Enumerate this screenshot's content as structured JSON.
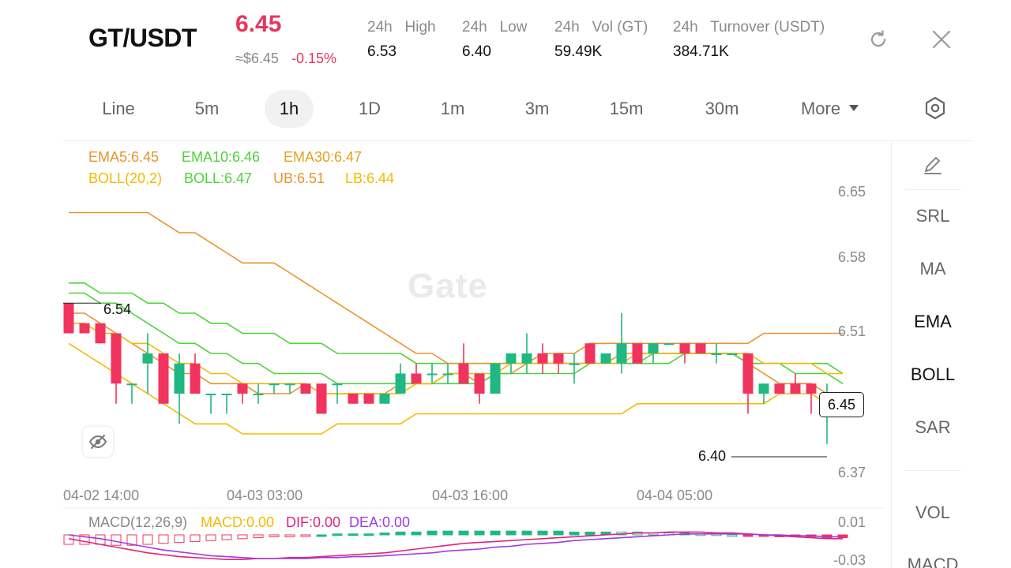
{
  "header": {
    "pair": "GT/USDT",
    "price": "6.45",
    "approx_usd": "≈$6.45",
    "change_pct": "-0.15%",
    "stats": [
      {
        "label": "24h   High",
        "value": "6.53"
      },
      {
        "label": "24h   Low",
        "value": "6.40"
      },
      {
        "label": "24h   Vol (GT)",
        "value": "59.49K"
      },
      {
        "label": "24h   Turnover (USDT)",
        "value": "384.71K"
      }
    ],
    "icons": [
      "refresh-icon",
      "close-icon"
    ]
  },
  "tabs": [
    {
      "label": "Line",
      "active": false
    },
    {
      "label": "5m",
      "active": false
    },
    {
      "label": "1h",
      "active": true
    },
    {
      "label": "1D",
      "active": false
    },
    {
      "label": "1m",
      "active": false
    },
    {
      "label": "3m",
      "active": false
    },
    {
      "label": "15m",
      "active": false
    },
    {
      "label": "30m",
      "active": false
    },
    {
      "label": "More",
      "active": false
    }
  ],
  "indicators": {
    "ema5": "EMA5:6.45",
    "ema10": "EMA10:6.46",
    "ema30": "EMA30:6.47",
    "boll_params": "BOLL(20,2)",
    "boll": "BOLL:6.47",
    "ub": "UB:6.51",
    "lb": "LB:6.44"
  },
  "macd": {
    "params": "MACD(12,26,9)",
    "macd": "MACD:0.00",
    "dif": "DIF:0.00",
    "dea": "DEA:0.00"
  },
  "sidepanel": [
    "SRL",
    "MA",
    "EMA",
    "BOLL",
    "SAR",
    "VOL",
    "MACD"
  ],
  "colors": {
    "up": "#1fb882",
    "down": "#f0345e",
    "ema5": "#e8932d",
    "ema10": "#4bd438",
    "ema30": "#e8a020",
    "boll": "#f5b800",
    "macd": "#f5b800",
    "dif": "#e0247d",
    "dea": "#a03be0"
  },
  "chart_data": {
    "type": "candlestick",
    "y_axis_ticks": [
      "6.65",
      "6.58",
      "6.51",
      "6.37"
    ],
    "x_axis_ticks": [
      "04-02 14:00",
      "04-03 03:00",
      "04-03 16:00",
      "04-04 05:00"
    ],
    "last_price": "6.45",
    "high_marker": "6.54",
    "low_marker": "6.40",
    "macd_axis": [
      "0.01",
      "-0.03"
    ],
    "candles": [
      {
        "o": 6.54,
        "h": 6.54,
        "l": 6.51,
        "c": 6.51
      },
      {
        "o": 6.52,
        "h": 6.52,
        "l": 6.51,
        "c": 6.51
      },
      {
        "o": 6.52,
        "h": 6.52,
        "l": 6.5,
        "c": 6.5
      },
      {
        "o": 6.51,
        "h": 6.51,
        "l": 6.44,
        "c": 6.46
      },
      {
        "o": 6.46,
        "h": 6.46,
        "l": 6.44,
        "c": 6.46
      },
      {
        "o": 6.48,
        "h": 6.51,
        "l": 6.45,
        "c": 6.49
      },
      {
        "o": 6.49,
        "h": 6.49,
        "l": 6.44,
        "c": 6.44
      },
      {
        "o": 6.45,
        "h": 6.49,
        "l": 6.42,
        "c": 6.48
      },
      {
        "o": 6.48,
        "h": 6.49,
        "l": 6.45,
        "c": 6.45
      },
      {
        "o": 6.45,
        "h": 6.45,
        "l": 6.43,
        "c": 6.45
      },
      {
        "o": 6.45,
        "h": 6.45,
        "l": 6.43,
        "c": 6.45
      },
      {
        "o": 6.46,
        "h": 6.46,
        "l": 6.44,
        "c": 6.45
      },
      {
        "o": 6.45,
        "h": 6.46,
        "l": 6.44,
        "c": 6.45
      },
      {
        "o": 6.46,
        "h": 6.46,
        "l": 6.45,
        "c": 6.46
      },
      {
        "o": 6.46,
        "h": 6.46,
        "l": 6.45,
        "c": 6.46
      },
      {
        "o": 6.46,
        "h": 6.46,
        "l": 6.45,
        "c": 6.45
      },
      {
        "o": 6.46,
        "h": 6.46,
        "l": 6.43,
        "c": 6.43
      },
      {
        "o": 6.46,
        "h": 6.46,
        "l": 6.44,
        "c": 6.46
      },
      {
        "o": 6.45,
        "h": 6.45,
        "l": 6.44,
        "c": 6.44
      },
      {
        "o": 6.45,
        "h": 6.45,
        "l": 6.44,
        "c": 6.44
      },
      {
        "o": 6.44,
        "h": 6.45,
        "l": 6.44,
        "c": 6.45
      },
      {
        "o": 6.45,
        "h": 6.48,
        "l": 6.45,
        "c": 6.47
      },
      {
        "o": 6.47,
        "h": 6.48,
        "l": 6.46,
        "c": 6.46
      },
      {
        "o": 6.47,
        "h": 6.48,
        "l": 6.46,
        "c": 6.47
      },
      {
        "o": 6.47,
        "h": 6.48,
        "l": 6.46,
        "c": 6.47
      },
      {
        "o": 6.48,
        "h": 6.5,
        "l": 6.46,
        "c": 6.46
      },
      {
        "o": 6.47,
        "h": 6.47,
        "l": 6.44,
        "c": 6.45
      },
      {
        "o": 6.45,
        "h": 6.48,
        "l": 6.45,
        "c": 6.48
      },
      {
        "o": 6.48,
        "h": 6.49,
        "l": 6.47,
        "c": 6.49
      },
      {
        "o": 6.48,
        "h": 6.51,
        "l": 6.47,
        "c": 6.49
      },
      {
        "o": 6.49,
        "h": 6.5,
        "l": 6.47,
        "c": 6.48
      },
      {
        "o": 6.49,
        "h": 6.49,
        "l": 6.47,
        "c": 6.48
      },
      {
        "o": 6.48,
        "h": 6.49,
        "l": 6.46,
        "c": 6.48
      },
      {
        "o": 6.5,
        "h": 6.5,
        "l": 6.48,
        "c": 6.48
      },
      {
        "o": 6.48,
        "h": 6.49,
        "l": 6.48,
        "c": 6.49
      },
      {
        "o": 6.48,
        "h": 6.53,
        "l": 6.47,
        "c": 6.5
      },
      {
        "o": 6.5,
        "h": 6.5,
        "l": 6.48,
        "c": 6.48
      },
      {
        "o": 6.49,
        "h": 6.5,
        "l": 6.48,
        "c": 6.5
      },
      {
        "o": 6.5,
        "h": 6.5,
        "l": 6.5,
        "c": 6.5
      },
      {
        "o": 6.5,
        "h": 6.5,
        "l": 6.48,
        "c": 6.49
      },
      {
        "o": 6.5,
        "h": 6.5,
        "l": 6.49,
        "c": 6.49
      },
      {
        "o": 6.49,
        "h": 6.5,
        "l": 6.48,
        "c": 6.49
      },
      {
        "o": 6.49,
        "h": 6.49,
        "l": 6.49,
        "c": 6.49
      },
      {
        "o": 6.49,
        "h": 6.49,
        "l": 6.43,
        "c": 6.45
      },
      {
        "o": 6.45,
        "h": 6.46,
        "l": 6.44,
        "c": 6.46
      },
      {
        "o": 6.46,
        "h": 6.46,
        "l": 6.45,
        "c": 6.45
      },
      {
        "o": 6.46,
        "h": 6.47,
        "l": 6.45,
        "c": 6.45
      },
      {
        "o": 6.46,
        "h": 6.46,
        "l": 6.43,
        "c": 6.45
      },
      {
        "o": 6.45,
        "h": 6.46,
        "l": 6.4,
        "c": 6.45
      },
      {
        "o": 6.45,
        "h": 6.45,
        "l": 6.45,
        "c": 6.45
      }
    ],
    "series": [
      {
        "name": "EMA5",
        "values": [
          6.53,
          6.53,
          6.52,
          6.51,
          6.5,
          6.49,
          6.48,
          6.47,
          6.47,
          6.46,
          6.46,
          6.46,
          6.45,
          6.45,
          6.45,
          6.46,
          6.45,
          6.45,
          6.45,
          6.45,
          6.45,
          6.46,
          6.46,
          6.46,
          6.47,
          6.47,
          6.46,
          6.47,
          6.47,
          6.48,
          6.48,
          6.48,
          6.48,
          6.48,
          6.48,
          6.49,
          6.49,
          6.49,
          6.49,
          6.49,
          6.49,
          6.49,
          6.49,
          6.48,
          6.47,
          6.46,
          6.46,
          6.46,
          6.45,
          6.45
        ]
      },
      {
        "name": "EMA10",
        "values": [
          6.55,
          6.55,
          6.54,
          6.54,
          6.53,
          6.52,
          6.51,
          6.5,
          6.5,
          6.49,
          6.49,
          6.48,
          6.48,
          6.47,
          6.47,
          6.47,
          6.47,
          6.46,
          6.46,
          6.46,
          6.46,
          6.46,
          6.46,
          6.46,
          6.46,
          6.46,
          6.46,
          6.47,
          6.47,
          6.47,
          6.47,
          6.47,
          6.47,
          6.48,
          6.48,
          6.48,
          6.48,
          6.48,
          6.48,
          6.49,
          6.49,
          6.49,
          6.49,
          6.48,
          6.48,
          6.48,
          6.47,
          6.47,
          6.47,
          6.46
        ]
      },
      {
        "name": "EMA30",
        "values": [
          6.56,
          6.56,
          6.55,
          6.55,
          6.55,
          6.54,
          6.54,
          6.53,
          6.53,
          6.52,
          6.52,
          6.51,
          6.51,
          6.51,
          6.5,
          6.5,
          6.5,
          6.49,
          6.49,
          6.49,
          6.49,
          6.49,
          6.48,
          6.48,
          6.48,
          6.48,
          6.48,
          6.48,
          6.48,
          6.48,
          6.48,
          6.48,
          6.48,
          6.48,
          6.48,
          6.48,
          6.48,
          6.49,
          6.49,
          6.49,
          6.49,
          6.49,
          6.49,
          6.48,
          6.48,
          6.48,
          6.48,
          6.48,
          6.48,
          6.47
        ]
      },
      {
        "name": "UB",
        "values": [
          6.63,
          6.63,
          6.63,
          6.63,
          6.63,
          6.63,
          6.62,
          6.61,
          6.61,
          6.6,
          6.59,
          6.58,
          6.58,
          6.58,
          6.57,
          6.56,
          6.55,
          6.54,
          6.53,
          6.52,
          6.51,
          6.5,
          6.49,
          6.49,
          6.48,
          6.48,
          6.48,
          6.48,
          6.48,
          6.48,
          6.49,
          6.49,
          6.49,
          6.5,
          6.5,
          6.5,
          6.5,
          6.5,
          6.5,
          6.5,
          6.5,
          6.5,
          6.5,
          6.5,
          6.51,
          6.51,
          6.51,
          6.51,
          6.51,
          6.51
        ]
      },
      {
        "name": "BOLL",
        "values": [
          6.52,
          6.52,
          6.51,
          6.51,
          6.5,
          6.5,
          6.49,
          6.48,
          6.48,
          6.47,
          6.47,
          6.46,
          6.46,
          6.46,
          6.46,
          6.46,
          6.45,
          6.45,
          6.45,
          6.45,
          6.45,
          6.45,
          6.46,
          6.46,
          6.47,
          6.47,
          6.47,
          6.47,
          6.48,
          6.48,
          6.48,
          6.48,
          6.48,
          6.48,
          6.48,
          6.48,
          6.49,
          6.49,
          6.49,
          6.49,
          6.49,
          6.49,
          6.49,
          6.49,
          6.48,
          6.48,
          6.48,
          6.48,
          6.47,
          6.47
        ]
      },
      {
        "name": "LB",
        "values": [
          6.5,
          6.49,
          6.48,
          6.47,
          6.46,
          6.45,
          6.44,
          6.43,
          6.42,
          6.42,
          6.42,
          6.41,
          6.41,
          6.41,
          6.41,
          6.41,
          6.41,
          6.42,
          6.42,
          6.42,
          6.42,
          6.42,
          6.43,
          6.43,
          6.43,
          6.43,
          6.43,
          6.43,
          6.43,
          6.43,
          6.43,
          6.43,
          6.43,
          6.43,
          6.43,
          6.43,
          6.44,
          6.44,
          6.44,
          6.44,
          6.44,
          6.44,
          6.44,
          6.44,
          6.44,
          6.45,
          6.45,
          6.45,
          6.44,
          6.44
        ]
      }
    ],
    "macd_hist": [
      -0.01,
      -0.01,
      -0.01,
      -0.011,
      -0.011,
      -0.01,
      -0.009,
      -0.008,
      -0.007,
      -0.006,
      -0.005,
      -0.004,
      -0.003,
      -0.002,
      -0.002,
      -0.001,
      0.0,
      0.001,
      0.001,
      0.001,
      0.002,
      0.003,
      0.003,
      0.004,
      0.004,
      0.004,
      0.004,
      0.004,
      0.004,
      0.004,
      0.004,
      0.004,
      0.003,
      0.003,
      0.003,
      0.003,
      0.003,
      0.002,
      0.002,
      0.002,
      0.001,
      0.001,
      0.0,
      -0.001,
      -0.001,
      -0.002,
      -0.002,
      -0.002,
      -0.003,
      -0.003
    ],
    "dif": [
      -0.004,
      -0.007,
      -0.01,
      -0.013,
      -0.016,
      -0.019,
      -0.021,
      -0.023,
      -0.024,
      -0.025,
      -0.026,
      -0.026,
      -0.025,
      -0.025,
      -0.024,
      -0.024,
      -0.023,
      -0.022,
      -0.021,
      -0.02,
      -0.019,
      -0.017,
      -0.015,
      -0.013,
      -0.011,
      -0.009,
      -0.008,
      -0.007,
      -0.006,
      -0.005,
      -0.004,
      -0.003,
      -0.002,
      -0.001,
      0.0,
      0.001,
      0.002,
      0.002,
      0.003,
      0.003,
      0.003,
      0.002,
      0.002,
      0.001,
      0.0,
      -0.001,
      -0.002,
      -0.003,
      -0.004,
      -0.004
    ],
    "dea": [
      0.0,
      -0.002,
      -0.004,
      -0.007,
      -0.01,
      -0.013,
      -0.016,
      -0.018,
      -0.02,
      -0.022,
      -0.023,
      -0.024,
      -0.025,
      -0.025,
      -0.025,
      -0.025,
      -0.024,
      -0.024,
      -0.023,
      -0.023,
      -0.022,
      -0.021,
      -0.02,
      -0.019,
      -0.017,
      -0.016,
      -0.015,
      -0.013,
      -0.012,
      -0.01,
      -0.009,
      -0.008,
      -0.006,
      -0.005,
      -0.004,
      -0.003,
      -0.002,
      -0.001,
      0.0,
      0.001,
      0.001,
      0.001,
      0.001,
      0.001,
      0.0,
      0.0,
      -0.001,
      -0.001,
      -0.002,
      -0.002
    ]
  }
}
